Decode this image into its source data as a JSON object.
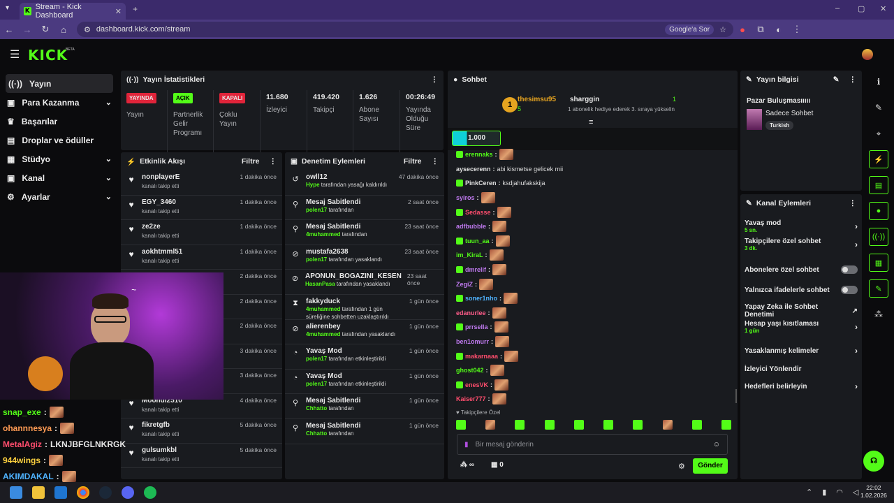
{
  "browser": {
    "tab_title": "Stream - Kick Dashboard",
    "url": "dashboard.kick.com/stream",
    "google_btn": "Google'a Sor"
  },
  "brand": {
    "logo": "KICK",
    "beta": "BETA",
    "accent": "#53fc18"
  },
  "sidebar": {
    "items": [
      {
        "label": "Yayın"
      },
      {
        "label": "Para Kazanma"
      },
      {
        "label": "Başarılar"
      },
      {
        "label": "Droplar ve ödüller"
      },
      {
        "label": "Stüdyo"
      },
      {
        "label": "Kanal"
      },
      {
        "label": "Ayarlar"
      }
    ]
  },
  "stats": {
    "title": "Yayın İstatistikleri",
    "cells": [
      {
        "badge": "YAYINDA",
        "label": "Yayın"
      },
      {
        "badge": "AÇIK",
        "label": "Partnerlik Gelir Programı"
      },
      {
        "badge": "KAPALI",
        "label": "Çoklu Yayın"
      },
      {
        "value": "11.680",
        "label": "İzleyici"
      },
      {
        "value": "419.420",
        "label": "Takipçi"
      },
      {
        "value": "1.626",
        "label": "Abone Sayısı"
      },
      {
        "value": "00:26:49",
        "label": "Yayında Olduğu Süre"
      }
    ]
  },
  "activity": {
    "title": "Etkinlik Akışı",
    "filter": "Filtre",
    "rows": [
      {
        "user": "nonplayerE",
        "sub": "kanalı takip etti",
        "time": "1 dakika önce"
      },
      {
        "user": "EGY_3460",
        "sub": "kanalı takip etti",
        "time": "1 dakika önce"
      },
      {
        "user": "ze2ze",
        "sub": "kanalı takip etti",
        "time": "1 dakika önce"
      },
      {
        "user": "aokhtmml51",
        "sub": "kanalı takip etti",
        "time": "1 dakika önce"
      },
      {
        "user": "",
        "sub": "",
        "time": "2 dakika önce"
      },
      {
        "user": "",
        "sub": "",
        "time": "2 dakika önce"
      },
      {
        "user": "",
        "sub": "",
        "time": "2 dakika önce"
      },
      {
        "user": "",
        "sub": "",
        "time": "3 dakika önce"
      },
      {
        "user": "",
        "sub": "",
        "time": "3 dakika önce"
      },
      {
        "user": "Moondi2510",
        "sub": "kanalı takip etti",
        "time": "4 dakika önce"
      },
      {
        "user": "fikretgfb",
        "sub": "kanalı takip etti",
        "time": "5 dakika önce"
      },
      {
        "user": "gulsumkbl",
        "sub": "kanalı takip etti",
        "time": "5 dakika önce"
      }
    ]
  },
  "moderation": {
    "title": "Denetim Eylemleri",
    "filter": "Filtre",
    "rows": [
      {
        "icon": "↺",
        "user": "owll12",
        "hl": "Hype",
        "sub": " tarafından yasağı kaldırıldı",
        "time": "47 dakika önce"
      },
      {
        "icon": "⚲",
        "user": "Mesaj Sabitlendi",
        "hl": "polen17",
        "sub": " tarafından",
        "time": "2 saat önce"
      },
      {
        "icon": "⚲",
        "user": "Mesaj Sabitlendi",
        "hl": "4muhammed",
        "sub": " tarafından",
        "time": "23 saat önce"
      },
      {
        "icon": "⊘",
        "user": "mustafa2638",
        "hl": "polen17",
        "sub": " tarafından yasaklandı",
        "time": "23 saat önce"
      },
      {
        "icon": "⊘",
        "user": "APONUN_BOGAZINI_KESEN",
        "hl": "HasanPasa",
        "sub": " tarafından yasaklandı",
        "time": "23 saat önce"
      },
      {
        "icon": "⧗",
        "user": "fakkyduck",
        "hl": "4muhammed",
        "sub": " tarafından 1 gün süreliğine sohbetten uzaklaştırıldı",
        "time": "1 gün önce"
      },
      {
        "icon": "⊘",
        "user": "alierenbey",
        "hl": "4muhammed",
        "sub": " tarafından yasaklandı",
        "time": "1 gün önce"
      },
      {
        "icon": "◔",
        "user": "Yavaş Mod",
        "hl": "polen17",
        "sub": " tarafından etkinleştirildi",
        "time": "1 gün önce"
      },
      {
        "icon": "◔",
        "user": "Yavaş Mod",
        "hl": "polen17",
        "sub": " tarafından etkinleştirildi",
        "time": "1 gün önce"
      },
      {
        "icon": "⚲",
        "user": "Mesaj Sabitlendi",
        "hl": "Chhatto",
        "sub": " tarafından",
        "time": "1 gün önce"
      },
      {
        "icon": "⚲",
        "user": "Mesaj Sabitlendi",
        "hl": "Chhatto",
        "sub": " tarafından",
        "time": "1 gün önce"
      }
    ]
  },
  "chat": {
    "title": "Sohbet",
    "top_gifter": "thesimsu95",
    "top_count": "5",
    "top_rank": "1",
    "gifter2": "sharggin",
    "gifter2_count": "1",
    "gifter2_msg": "1 abonelik hediye ederek 3. sıraya yükselin",
    "pinned_count": "1.000",
    "input_placeholder": "Bir mesaj gönderin",
    "send": "Gönder",
    "followers_only": "Takipçilere Özel",
    "points": "∞",
    "pts2": "0",
    "messages": [
      {
        "user": "erennaks",
        "color": "#53fc18",
        "text": ""
      },
      {
        "user": "aysecerenn",
        "color": "#e0e0e0",
        "text": "abi kismetse gelicek mii"
      },
      {
        "user": "PinkCeren",
        "color": "#e0e0e0",
        "text": "ksdjahufakskija"
      },
      {
        "user": "syiros",
        "color": "#c07af0",
        "text": ""
      },
      {
        "user": "Sedasse",
        "color": "#ff4d6d",
        "text": ""
      },
      {
        "user": "adfbubble",
        "color": "#c07af0",
        "text": ""
      },
      {
        "user": "tuun_aa",
        "color": "#53fc18",
        "text": ""
      },
      {
        "user": "im_KiraL",
        "color": "#53fc18",
        "text": ""
      },
      {
        "user": "dmrelif",
        "color": "#c07af0",
        "text": ""
      },
      {
        "user": "ZegiZ",
        "color": "#c07af0",
        "text": ""
      },
      {
        "user": "soner1nho",
        "color": "#4fb3ff",
        "text": ""
      },
      {
        "user": "edanurlee",
        "color": "#ff5c8a",
        "text": ""
      },
      {
        "user": "prrsella",
        "color": "#c07af0",
        "text": ""
      },
      {
        "user": "ben1omurr",
        "color": "#c07af0",
        "text": ""
      },
      {
        "user": "makarnaaa",
        "color": "#ff4d6d",
        "text": ""
      },
      {
        "user": "ghost042",
        "color": "#53fc18",
        "text": ""
      },
      {
        "user": "enesVK",
        "color": "#ff4d6d",
        "text": ""
      },
      {
        "user": "Kaiser777",
        "color": "#ff4d6d",
        "text": ""
      }
    ]
  },
  "overlay_chat": [
    {
      "user": "snap_exe",
      "color": "#53fc18",
      "text": ""
    },
    {
      "user": "ohannnesya",
      "color": "#ff9b54",
      "text": ""
    },
    {
      "user": "MetalAgiz",
      "color": "#ff4d6d",
      "text": "LKNJBFGLNKRGK"
    },
    {
      "user": "944wings",
      "color": "#ffd23f",
      "text": ""
    },
    {
      "user": "AKIMDAKAL",
      "color": "#4fb3ff",
      "text": ""
    }
  ],
  "stream_info": {
    "title": "Yayın bilgisi",
    "stream_title": "Pazar Buluşmasııııı",
    "category": "Sadece Sohbet",
    "tag": "Turkish"
  },
  "channel_actions": {
    "title": "Kanal Eylemleri",
    "items": [
      {
        "label": "Yavaş mod",
        "sub": "5 sn.",
        "ctrl": "chevron"
      },
      {
        "label": "Takipçilere özel sohbet",
        "sub": "3 dk.",
        "ctrl": "chevron"
      },
      {
        "label": "Abonelere özel sohbet",
        "sub": "",
        "ctrl": "toggle"
      },
      {
        "label": "Yalnızca ifadelerle sohbet",
        "sub": "",
        "ctrl": "toggle"
      },
      {
        "label": "Yapay Zeka ile Sohbet Denetimi",
        "sub": "",
        "ctrl": "external"
      },
      {
        "label": "Hesap yaşı kısıtlaması",
        "sub": "1 gün",
        "ctrl": "chevron"
      },
      {
        "label": "Yasaklanmış kelimeler",
        "sub": "",
        "ctrl": "chevron"
      },
      {
        "label": "İzleyici Yönlendir",
        "sub": "",
        "ctrl": "none"
      },
      {
        "label": "Hedefleri belirleyin",
        "sub": "",
        "ctrl": "chevron"
      }
    ]
  },
  "taskbar": {
    "time": "22:02",
    "date": "1.02.2026"
  }
}
